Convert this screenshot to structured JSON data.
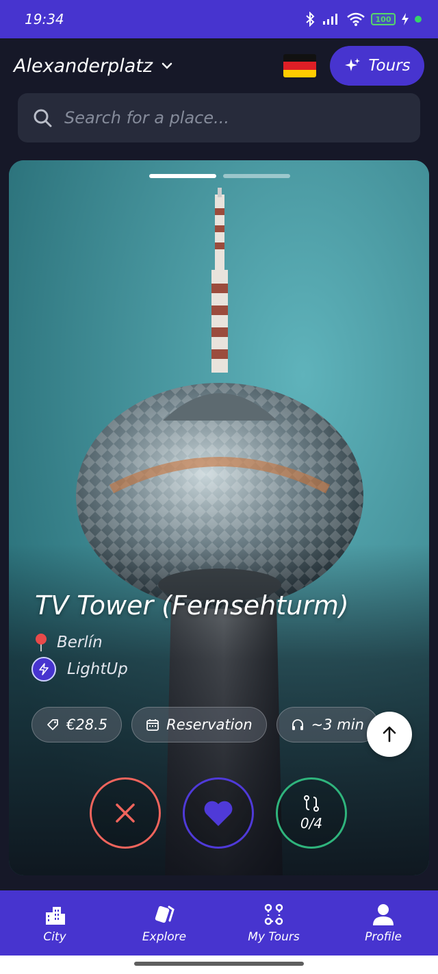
{
  "status_bar": {
    "time": "19:34",
    "battery": "100",
    "icons": [
      "bluetooth-icon",
      "signal-icon",
      "wifi-icon",
      "battery-icon",
      "charging-icon"
    ]
  },
  "header": {
    "location": "Alexanderplatz",
    "flag": "germany-flag",
    "tours_label": "Tours"
  },
  "search": {
    "placeholder": "Search for a place..."
  },
  "card": {
    "image_count": 2,
    "active_image": 1,
    "title": "TV Tower (Fernsehturm)",
    "city": "Berlín",
    "category": "LightUp",
    "chips": {
      "price": "€28.5",
      "reservation": "Reservation",
      "duration": "~3 min"
    },
    "route_progress": "0/4"
  },
  "bottom_nav": {
    "items": [
      {
        "label": "City",
        "icon": "city-icon"
      },
      {
        "label": "Explore",
        "icon": "explore-cards-icon"
      },
      {
        "label": "My Tours",
        "icon": "route-icon"
      },
      {
        "label": "Profile",
        "icon": "profile-icon"
      }
    ]
  },
  "colors": {
    "brand": "#4734cf",
    "background": "#161828",
    "search_bg": "#272b3b",
    "dislike": "#f0645c",
    "route": "#2fb47c"
  }
}
